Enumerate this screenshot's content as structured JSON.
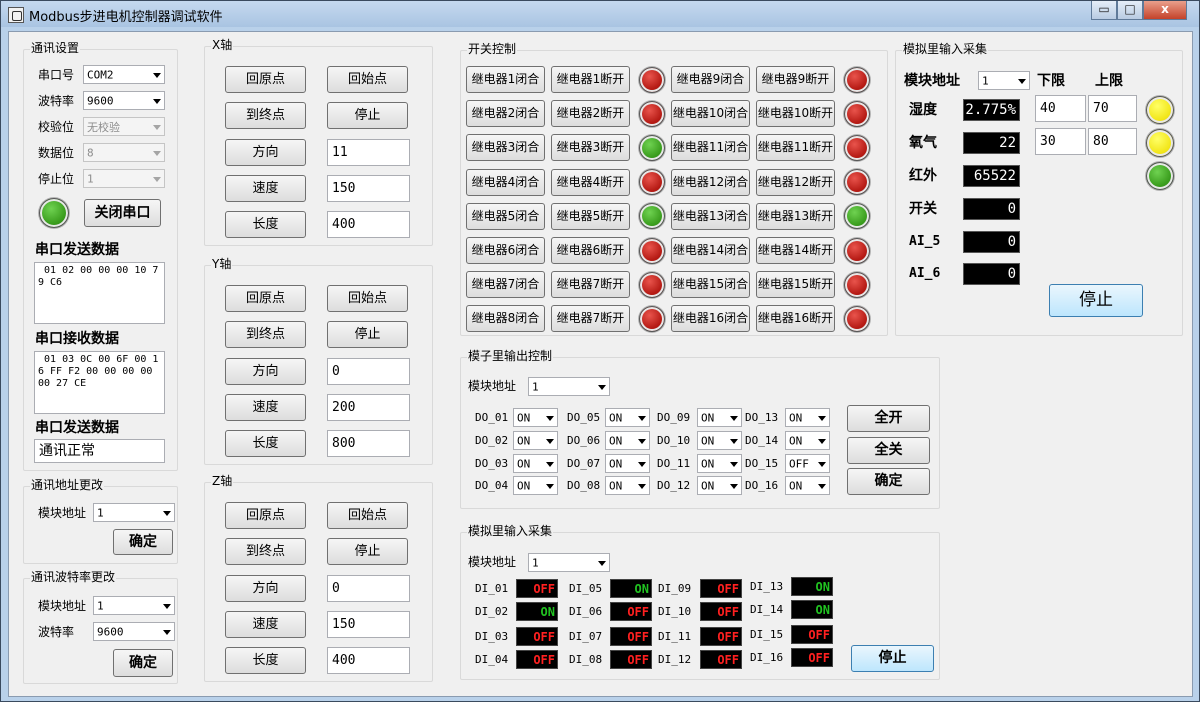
{
  "app": {
    "title": "Modbus步进电机控制器调试软件",
    "min": "▭",
    "max": "□",
    "close": "x"
  },
  "comm": {
    "title": "通讯设置",
    "port_label": "串口号",
    "port_value": "COM2",
    "baud_label": "波特率",
    "baud_value": "9600",
    "parity_label": "校验位",
    "parity_value": "无校验",
    "databits_label": "数据位",
    "databits_value": "8",
    "stopbits_label": "停止位",
    "stopbits_value": "1",
    "close_port_label": "关闭串口",
    "send_title": "串口发送数据",
    "send_data": " 01 02 00 00 00 10 79 C6",
    "recv_title": "串口接收数据",
    "recv_data": " 01 03 0C 00 6F 00 16 FF F2 00 00 00 00 00 27 CE",
    "send_title2": "串口发送数据",
    "status": "通讯正常"
  },
  "addr_change": {
    "title": "通讯地址更改",
    "module_label": "模块地址",
    "module_value": "1",
    "confirm": "确定"
  },
  "baud_change": {
    "title": "通讯波特率更改",
    "module_label": "模块地址",
    "module_value": "1",
    "baud_label": "波特率",
    "baud_value": "9600",
    "confirm": "确定"
  },
  "labels": {
    "home": "回原点",
    "start": "回始点",
    "end": "到终点",
    "stop": "停止",
    "dir": "方向",
    "speed": "速度",
    "length": "长度"
  },
  "axes": [
    {
      "title": "X轴",
      "dir": "11",
      "speed": "150",
      "length": "400"
    },
    {
      "title": "Y轴",
      "dir": "0",
      "speed": "200",
      "length": "800"
    },
    {
      "title": "Z轴",
      "dir": "0",
      "speed": "150",
      "length": "400"
    }
  ],
  "switch": {
    "title": "开关控制",
    "left": [
      {
        "close": "继电器1闭合",
        "open": "继电器1断开",
        "state": "red"
      },
      {
        "close": "继电器2闭合",
        "open": "继电器2断开",
        "state": "red"
      },
      {
        "close": "继电器3闭合",
        "open": "继电器3断开",
        "state": "green"
      },
      {
        "close": "继电器4闭合",
        "open": "继电器4断开",
        "state": "red"
      },
      {
        "close": "继电器5闭合",
        "open": "继电器5断开",
        "state": "green"
      },
      {
        "close": "继电器6闭合",
        "open": "继电器6断开",
        "state": "red"
      },
      {
        "close": "继电器7闭合",
        "open": "继电器7断开",
        "state": "red"
      },
      {
        "close": "继电器8闭合",
        "open": "继电器7断开",
        "state": "red"
      }
    ],
    "right": [
      {
        "close": "继电器9闭合",
        "open": "继电器9断开",
        "state": "red"
      },
      {
        "close": "继电器10闭合",
        "open": "继电器10断开",
        "state": "red"
      },
      {
        "close": "继电器11闭合",
        "open": "继电器11断开",
        "state": "red"
      },
      {
        "close": "继电器12闭合",
        "open": "继电器12断开",
        "state": "red"
      },
      {
        "close": "继电器13闭合",
        "open": "继电器13断开",
        "state": "green"
      },
      {
        "close": "继电器14闭合",
        "open": "继电器14断开",
        "state": "red"
      },
      {
        "close": "继电器15闭合",
        "open": "继电器15断开",
        "state": "red"
      },
      {
        "close": "继电器16闭合",
        "open": "继电器16断开",
        "state": "red"
      }
    ]
  },
  "analog": {
    "title": "模拟里输入采集",
    "module_label": "模块地址",
    "module_value": "1",
    "low_label": "下限",
    "high_label": "上限",
    "rows": [
      {
        "label": "湿度",
        "value": "2.775%",
        "low": "40",
        "high": "70",
        "led": "yellow"
      },
      {
        "label": "氧气",
        "value": "22",
        "low": "30",
        "high": "80",
        "led": "yellow"
      },
      {
        "label": "红外",
        "value": "65522",
        "led": "green"
      },
      {
        "label": "开关",
        "value": "0"
      },
      {
        "label": "AI_5",
        "value": "0"
      },
      {
        "label": "AI_6",
        "value": "0"
      }
    ],
    "stop": "停止"
  },
  "do_ctrl": {
    "title": "模子里输出控制",
    "module_label": "模块地址",
    "module_value": "1",
    "items": [
      {
        "label": "DO_01",
        "value": "ON"
      },
      {
        "label": "DO_05",
        "value": "ON"
      },
      {
        "label": "DO_09",
        "value": "ON"
      },
      {
        "label": "DO_13",
        "value": "ON"
      },
      {
        "label": "DO_02",
        "value": "ON"
      },
      {
        "label": "DO_06",
        "value": "ON"
      },
      {
        "label": "DO_10",
        "value": "ON"
      },
      {
        "label": "DO_14",
        "value": "ON"
      },
      {
        "label": "DO_03",
        "value": "ON"
      },
      {
        "label": "DO_07",
        "value": "ON"
      },
      {
        "label": "DO_11",
        "value": "ON"
      },
      {
        "label": "DO_15",
        "value": "OFF"
      },
      {
        "label": "DO_04",
        "value": "ON"
      },
      {
        "label": "DO_08",
        "value": "ON"
      },
      {
        "label": "DO_12",
        "value": "ON"
      },
      {
        "label": "DO_16",
        "value": "ON"
      }
    ],
    "all_on": "全开",
    "all_off": "全关",
    "confirm": "确定"
  },
  "di_in": {
    "title": "模拟里输入采集",
    "module_label": "模块地址",
    "module_value": "1",
    "items": [
      {
        "label": "DI_01",
        "value": "OFF"
      },
      {
        "label": "DI_05",
        "value": "ON"
      },
      {
        "label": "DI_09",
        "value": "OFF"
      },
      {
        "label": "DI_13",
        "value": "ON"
      },
      {
        "label": "DI_02",
        "value": "ON"
      },
      {
        "label": "DI_06",
        "value": "OFF"
      },
      {
        "label": "DI_10",
        "value": "OFF"
      },
      {
        "label": "DI_14",
        "value": "ON"
      },
      {
        "label": "DI_03",
        "value": "OFF"
      },
      {
        "label": "DI_07",
        "value": "OFF"
      },
      {
        "label": "DI_11",
        "value": "OFF"
      },
      {
        "label": "DI_15",
        "value": "OFF"
      },
      {
        "label": "DI_04",
        "value": "OFF"
      },
      {
        "label": "DI_08",
        "value": "OFF"
      },
      {
        "label": "DI_12",
        "value": "OFF"
      },
      {
        "label": "DI_16",
        "value": "OFF"
      }
    ],
    "stop": "停止"
  }
}
